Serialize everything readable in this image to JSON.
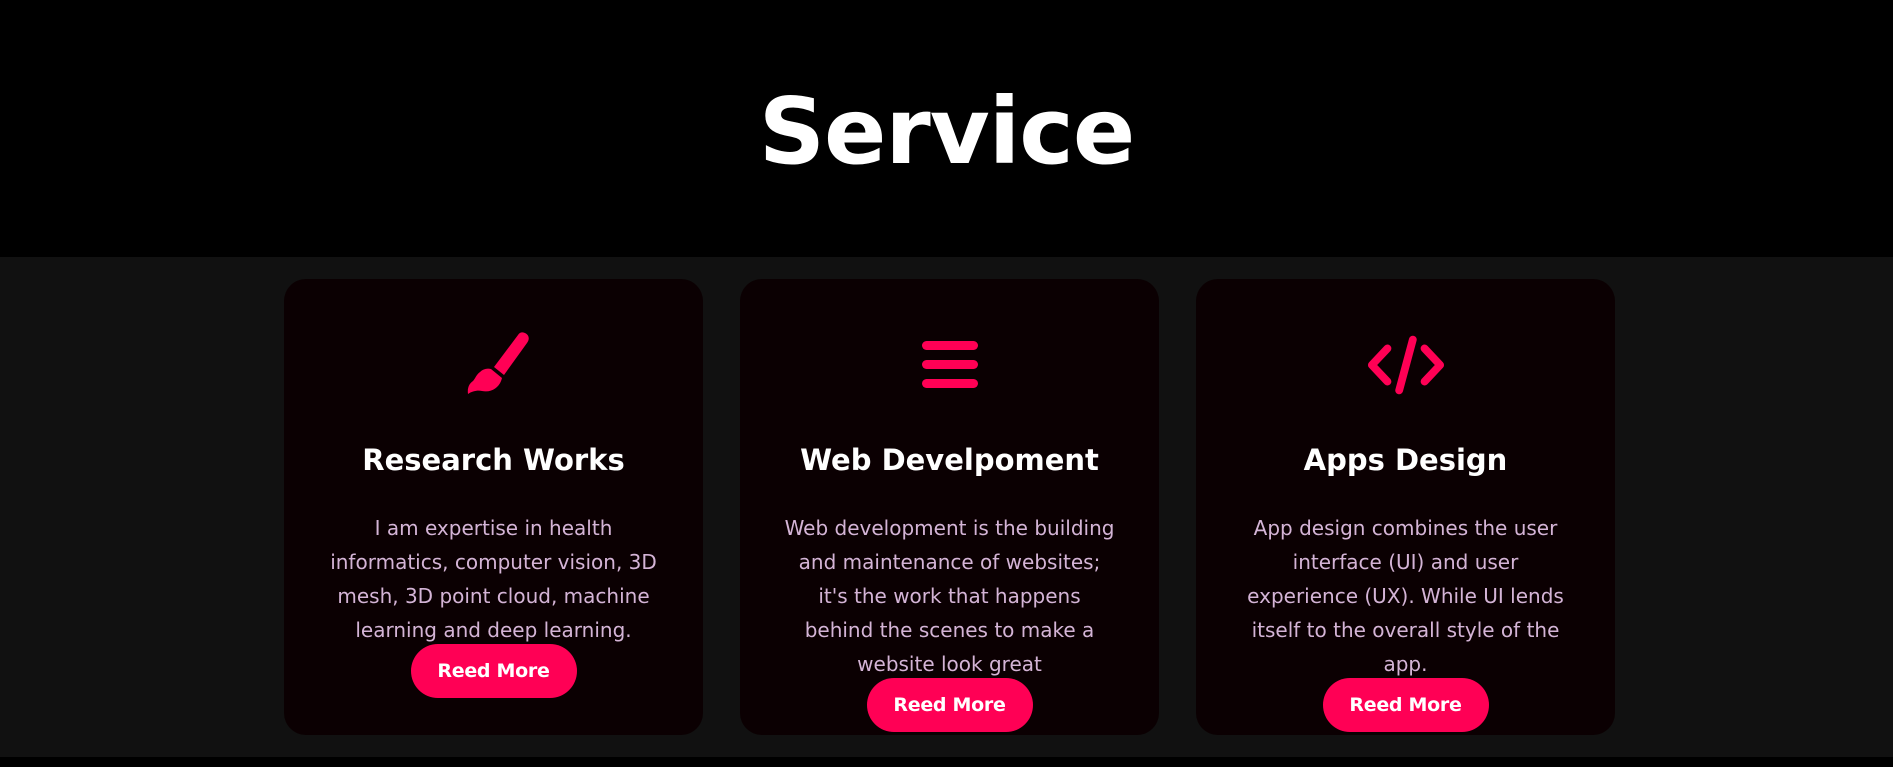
{
  "section": {
    "title": "Service"
  },
  "colors": {
    "accent": "#ff0055",
    "card_background": "#0b0002",
    "section_background": "#111111",
    "description_text": "#d4b4d6"
  },
  "cards": [
    {
      "icon": "paintbrush-icon",
      "title": "Research Works",
      "description": "I am expertise in health informatics, computer vision, 3D mesh, 3D point cloud, machine learning and deep learning.",
      "button_label": "Reed More"
    },
    {
      "icon": "hamburger-menu-icon",
      "title": "Web Develpoment",
      "description": "Web development is the building and maintenance of websites; it's the work that happens behind the scenes to make a website look great",
      "button_label": "Reed More"
    },
    {
      "icon": "code-icon",
      "title": "Apps Design",
      "description": "App design combines the user interface (UI) and user experience (UX). While UI lends itself to the overall style of the app.",
      "button_label": "Reed More"
    }
  ]
}
